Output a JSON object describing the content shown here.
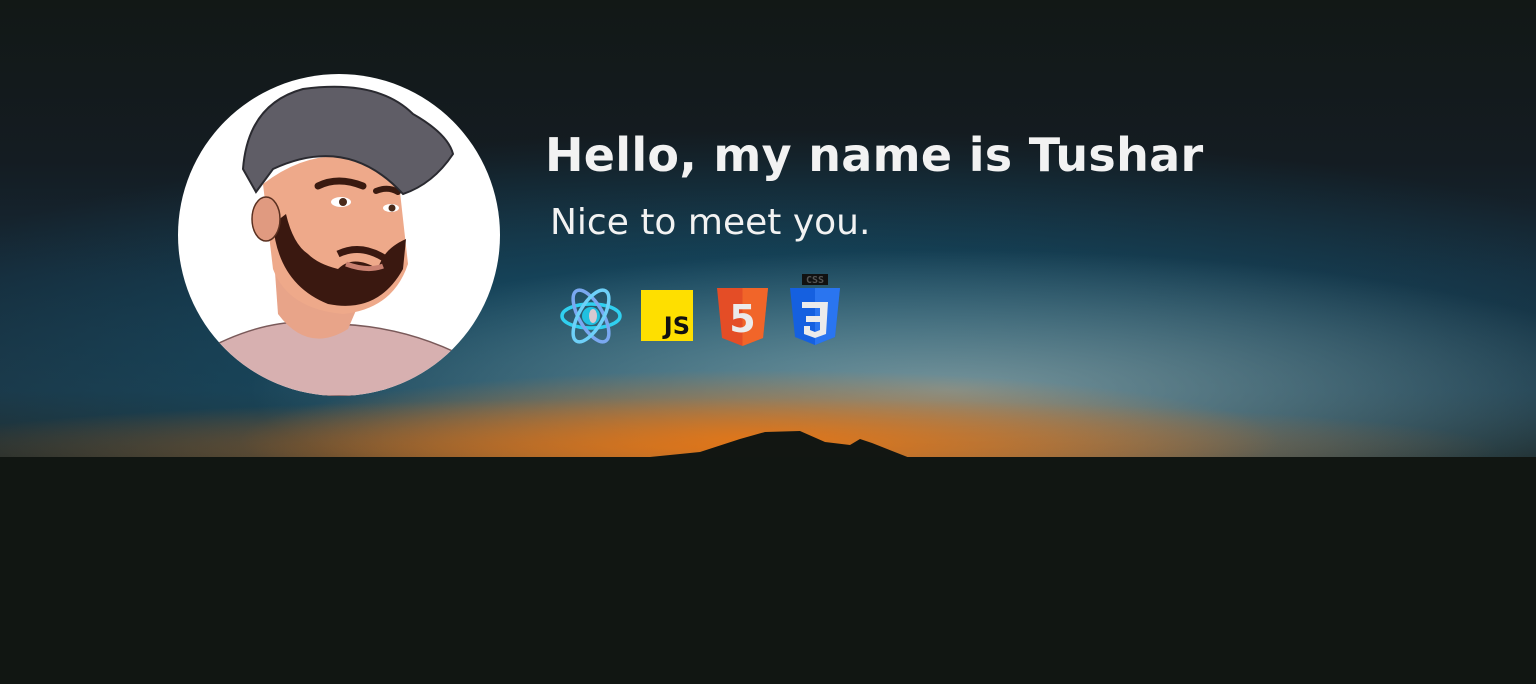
{
  "hero": {
    "title": "Hello, my name is Tushar",
    "subtitle": "Nice to meet you."
  },
  "skills": [
    {
      "icon": "react-icon"
    },
    {
      "icon": "javascript-icon",
      "label": "JS"
    },
    {
      "icon": "html5-icon",
      "label": "5"
    },
    {
      "icon": "css3-icon",
      "label": "CSS"
    }
  ],
  "colors": {
    "js": "#f7df1e",
    "html": "#e44d26",
    "css": "#1572b6",
    "react": "#61dafb"
  }
}
